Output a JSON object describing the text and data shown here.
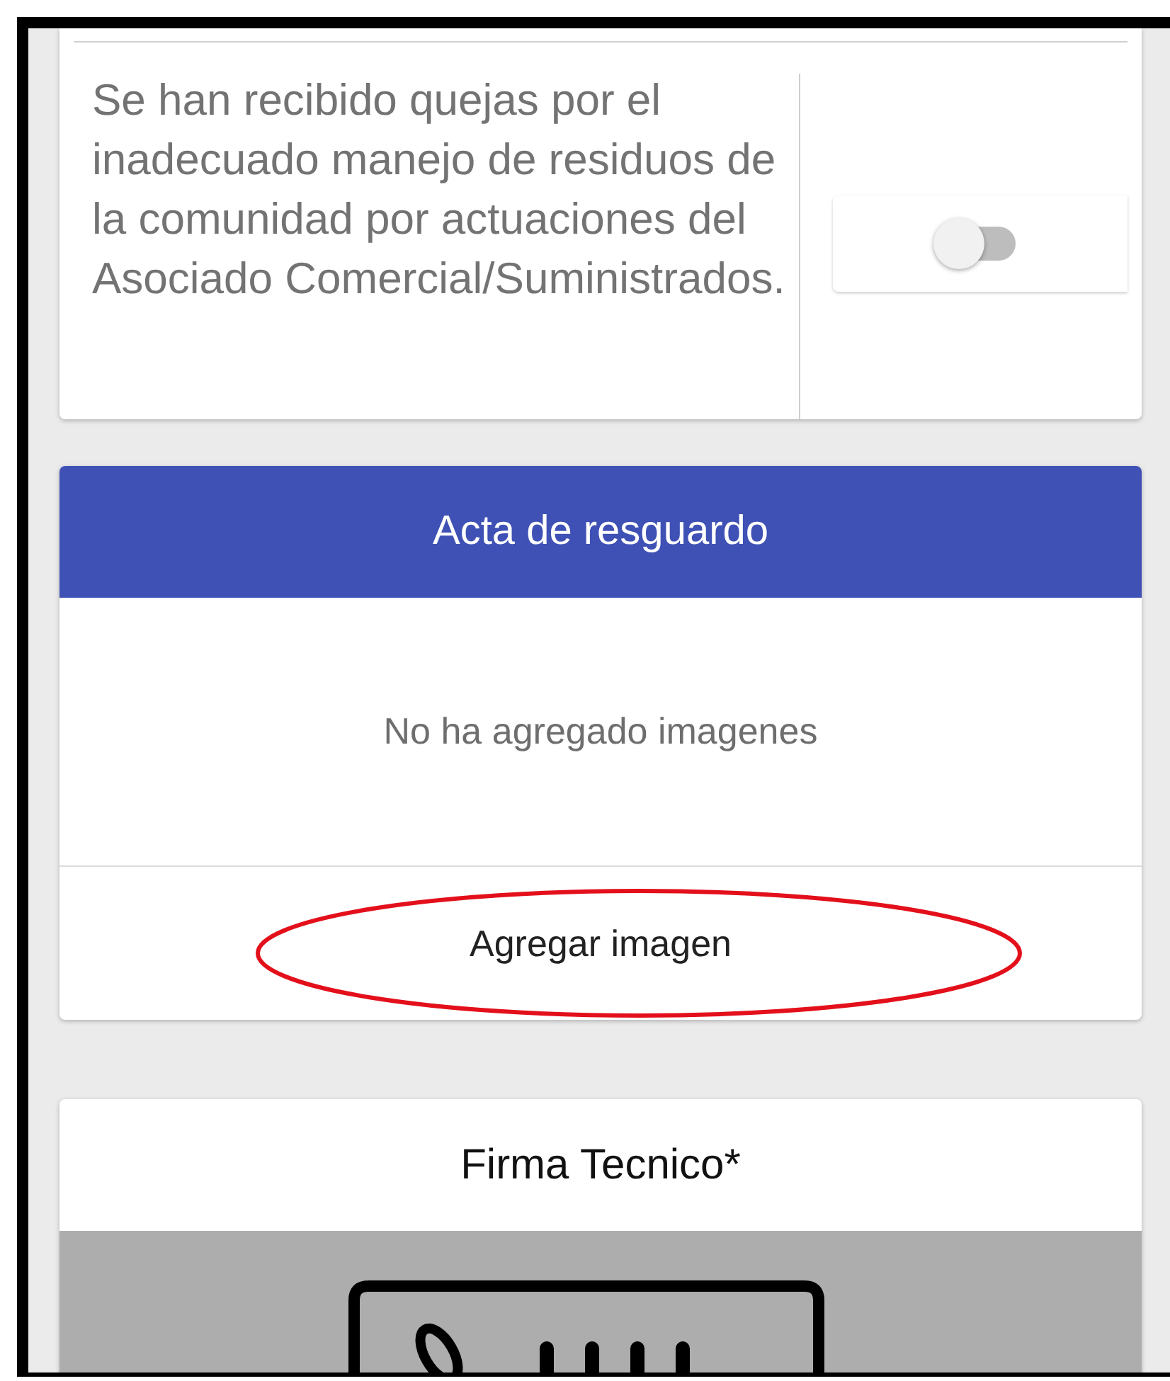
{
  "question_card": {
    "text": "Se han recibido quejas por el inadecuado manejo de residuos de la comunidad por actuaciones del Asociado Comercial/Suministrados.",
    "toggle": {
      "on": false
    }
  },
  "photo_section": {
    "title": "Acta de resguardo",
    "empty_message": "No ha agregado imagenes",
    "add_button": "Agregar imagen",
    "highlighted": true
  },
  "signature_section": {
    "title": "Firma Tecnico*"
  }
}
